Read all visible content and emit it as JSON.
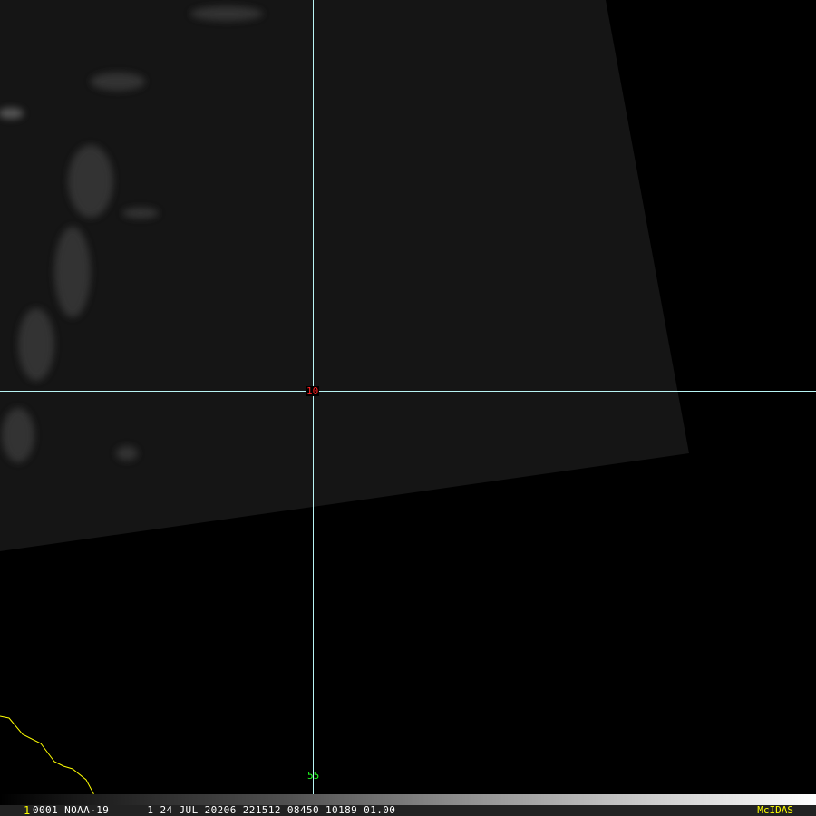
{
  "frame_number": "1",
  "info_line": "0001 NOAA-19      1 24 JUL 20206 221512 08450 10189 01.00",
  "brand": "McIDAS",
  "center_label": "10",
  "bottom_label": "55",
  "colors": {
    "crosshair": "#9ff4f4",
    "center_label": "#ff2020",
    "bottom_label": "#20ff20",
    "coastline": "#ffff00",
    "brand": "#ffff00"
  }
}
